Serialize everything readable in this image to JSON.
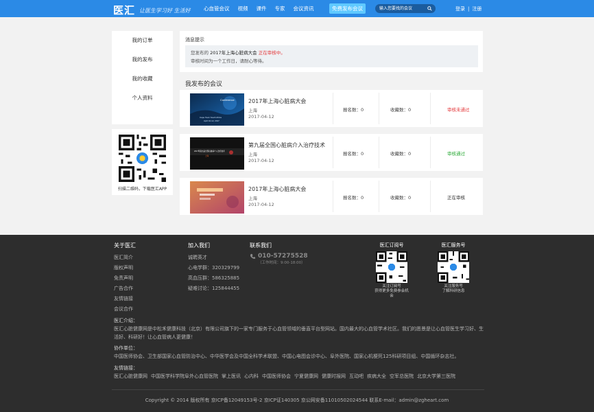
{
  "header": {
    "logo": "医汇",
    "slogan": "让医生学习好 生活好",
    "nav": [
      "心血管会议",
      "视频",
      "课件",
      "专家",
      "会议资讯"
    ],
    "publish_button": "免费发布会议",
    "search_placeholder": "输入您要找的会议",
    "login": "登录",
    "separator": "|",
    "register": "注册",
    "colors": {
      "bar": "#2b8ae6",
      "publish": "#5fc9ff"
    }
  },
  "sidebar": {
    "items": [
      {
        "label": "我的订单"
      },
      {
        "label": "我的发布"
      },
      {
        "label": "我的收藏"
      },
      {
        "label": "个人资料"
      }
    ],
    "qr_caption": "扫描二维码，下载医汇APP"
  },
  "notice": {
    "title": "消息提示",
    "line1_prefix": "您发布的",
    "line1_conference": "2017年上海心脏病大会",
    "line1_status": "正在审核中。",
    "line2": "审核时间为一个工作日，请耐心等待。"
  },
  "section_title": "我发布的会议",
  "meetings": [
    {
      "title": "2017年上海心脏病大会",
      "city": "上海",
      "date": "2017-04-12",
      "signup": "报名数：0",
      "favorites": "收藏数：0",
      "status": "审核未通过",
      "status_color": "#e4393c",
      "thumb_title": "Conference",
      "thumb_subtitle": "Cape Town South Africa",
      "thumb_date": "April 10-12, 2017"
    },
    {
      "title": "第九届全国心脏病介入治疗技术",
      "city": "上海",
      "date": "2017-04-12",
      "signup": "报名数：0",
      "favorites": "收藏数：0",
      "status": "审核通过",
      "status_color": "#2eab3a",
      "thumb_title": "2017年第九届全国心脏病介入治疗技术",
      "thumb_subtitle": "上海",
      "thumb_date": ""
    },
    {
      "title": "2017年上海心脏病大会",
      "city": "上海",
      "date": "2017-04-12",
      "signup": "报名数：0",
      "favorites": "收藏数：0",
      "status": "正在审核",
      "status_color": "#333333",
      "thumb_title": "",
      "thumb_subtitle": "",
      "thumb_date": ""
    }
  ],
  "footer": {
    "about": {
      "title": "关于医汇",
      "items": [
        "医汇简介",
        "版权声明",
        "免责声明",
        "广告合作",
        "友情链接",
        "会议合作"
      ]
    },
    "join": {
      "title": "加入我们",
      "items": [
        "诚聘英才",
        "心电学群：320329799",
        "高血压群：586325885",
        "疑难讨论：125844455"
      ]
    },
    "contact": {
      "title": "联系我们",
      "phone": "010-57275528",
      "hours": "（工作时间：9:00-18:00）"
    },
    "qr1": {
      "title": "医汇订阅号",
      "note1": "关注订阅号",
      "note2": "获得更多免费参会机会"
    },
    "qr2": {
      "title": "医汇服务号",
      "note1": "关注服务号",
      "note2": "了解科研信息"
    },
    "intro_label": "医汇介绍：",
    "intro_text": "医汇心脏健康网是中松禾健康科技（北京）有限公司旗下的一家专门服务于心血管领域的垂直平台型网站。国内最大的心血管学术社区。我们的愿景是让心血管医生学习好、生活好、科研好！让心血管病人更健康！",
    "partners_label": "协作单位：",
    "partners_text": "中国医师协会、卫生部国家心血管防治中心、中华医学会及中国全科学术联盟、中国心电图会诊中心、阜外医院、国家心机梗死125科研项目组、中国循环杂志社。",
    "links_label": "友情链接：",
    "links": [
      "医汇心脏健康网",
      "中国医学科学院阜外心血管医院",
      "掌上医讯",
      "心内科",
      "中国医师协会",
      "宁夏健康网",
      "健康时报网",
      "互动吧",
      "疾病大全",
      "空军总医院",
      "北京大学第三医院"
    ],
    "copyright": "Copyright © 2014 版权所有   京ICP备12049153号-2   京ICP证140305   京公网安备11010502024544    联系E-mail：admin@zgheart.com"
  }
}
